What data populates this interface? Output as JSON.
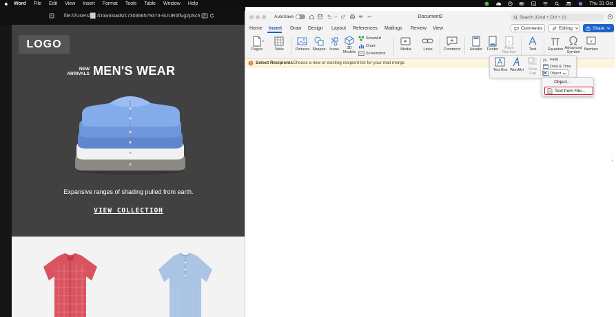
{
  "menubar": {
    "app": "Word",
    "items": [
      "File",
      "Edit",
      "View",
      "Insert",
      "Format",
      "Tools",
      "Table",
      "Window",
      "Help"
    ],
    "clock": "Thu 31 Oct"
  },
  "browser": {
    "url": "file:///Users/█▌/Downloads/1730366579373-6UURbflug2pSc50",
    "logo": "LOGO",
    "new_arrivals": "NEW\nARRIVALS",
    "headline": "MEN'S WEAR",
    "tagline": "Expansive ranges of shading pulled from earth.",
    "cta": "VIEW COLLECTION",
    "colors": {
      "hero_bg": "#414141",
      "products_bg": "#f3f3f3",
      "shirt_red": "#d9545f",
      "shirt_blue": "#aac4e4"
    }
  },
  "word": {
    "autosave_label": "AutoSave",
    "doc_title": "Document2",
    "search_placeholder": "Search (Cmd + Ctrl + U)",
    "tabs": [
      "Home",
      "Insert",
      "Draw",
      "Design",
      "Layout",
      "References",
      "Mailings",
      "Review",
      "View"
    ],
    "active_tab": "Insert",
    "comments_label": "Comments",
    "editing_label": "Editing",
    "share_label": "Share",
    "ribbon": {
      "pages": "Pages",
      "table": "Table",
      "pictures": "Pictures",
      "shapes": "Shapes",
      "icons": "Icons",
      "models": "3D\nModels",
      "smartart": "SmartArt",
      "chart": "Chart",
      "screenshot": "Screenshot",
      "media": "Media",
      "links": "Links",
      "comment": "Comment",
      "header": "Header",
      "footer": "Footer",
      "page_number": "Page\nNumber",
      "text": "Text",
      "equation": "Equation",
      "advanced_symbol": "Advanced\nSymbol",
      "number": "Number"
    },
    "message_bar": {
      "title": "Select Recipients",
      "text": "Choose a new or existing recipient list for your mail merge."
    },
    "text_popup": {
      "text_box": "Text Box",
      "wordart": "WordArt",
      "drop_cap": "Drop\nCap",
      "field": "Field",
      "date_time": "Date & Time",
      "object": "Object"
    },
    "object_menu": {
      "object": "Object...",
      "text_from_file": "Text from File..."
    },
    "colors": {
      "accent": "#1b5fb3",
      "share_bg": "#1e63c9",
      "highlight_border": "#d6202a",
      "message_bg": "#fdf6dc"
    }
  }
}
